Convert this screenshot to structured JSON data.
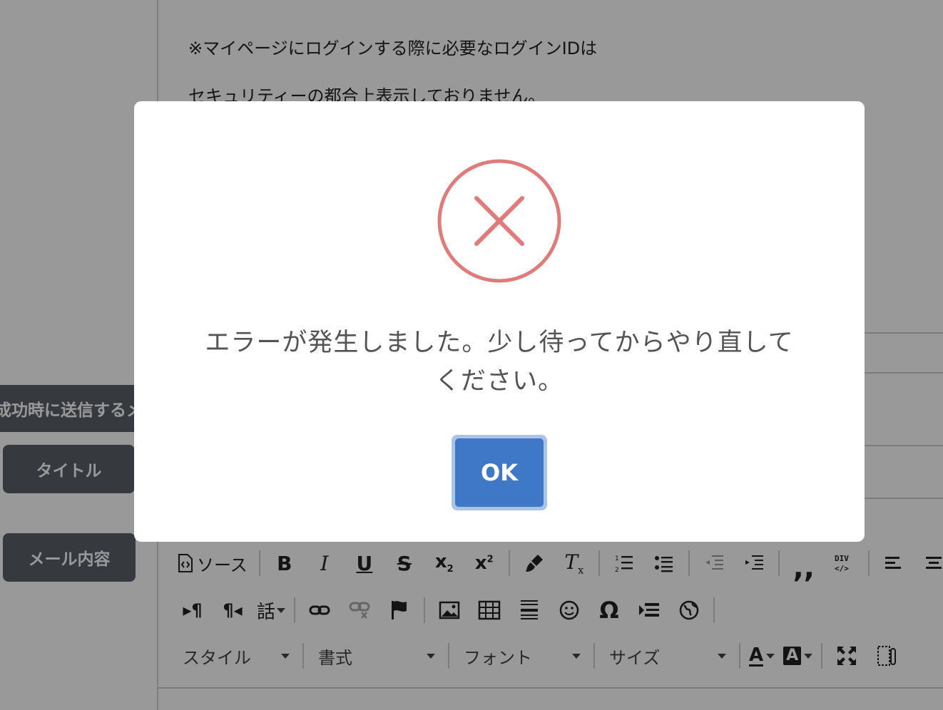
{
  "background": {
    "content_lines": [
      "※マイページにログインする際に必要なログインIDは",
      "セキュリティーの都合上表示しておりません。"
    ],
    "side_buttons": {
      "success_label": "成功時に送信するメ",
      "title": "タイトル",
      "mail_content": "メール内容"
    },
    "toolbar": {
      "source_label": "ソース",
      "lang_label": "話",
      "style_combo": "スタイル",
      "format_combo": "書式",
      "font_combo": "フォント",
      "size_combo": "サイズ"
    }
  },
  "dialog": {
    "icon": "error-x-icon",
    "message_line1": "エラーが発生しました。少し待ってからやり直して",
    "message_line2": "ください。",
    "ok_label": "OK",
    "colors": {
      "icon": "#e07b7b",
      "ok_button": "#3f78c6",
      "overlay": "rgba(0,0,0,0.40)"
    }
  }
}
